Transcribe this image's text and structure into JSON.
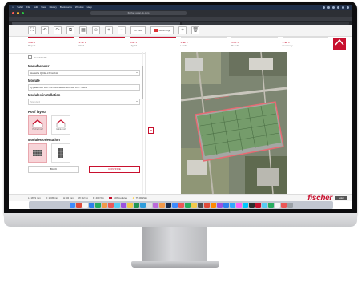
{
  "browser": {
    "menubar_items": [
      "Safari",
      "File",
      "Edit",
      "View",
      "History",
      "Bookmarks",
      "Window",
      "Help"
    ],
    "url": "fischer-solar-fix.com"
  },
  "toolbar": {
    "view_select": "2D view",
    "color_select": "Bleu/rouge"
  },
  "steps": [
    {
      "num": "STEP 1",
      "label": "Project"
    },
    {
      "num": "STEP 2",
      "label": "Roof"
    },
    {
      "num": "STEP 3",
      "label": "Layout"
    },
    {
      "num": "STEP 4",
      "label": "Loads"
    },
    {
      "num": "STEP 5",
      "label": "Results"
    },
    {
      "num": "STEP 6",
      "label": "Summary"
    }
  ],
  "logo_text": "fischer",
  "panel": {
    "use_defaults": "Use defaults",
    "manufacturer_label": "Manufacturer",
    "manufacturer_value": "Hanwha Q CELLS GmbH",
    "module_label": "Module",
    "module_value": "Q.peak Duo BLK ML-G10 Series 385 400 Wp - 400W",
    "modules_installation_label": "Modules installation",
    "modules_installation_value": "Standard",
    "roof_layout_label": "Roof layout",
    "roof_options": [
      "Pitched roof",
      "Gable roof"
    ],
    "modules_orientation_label": "Modules orientation",
    "back": "BACK",
    "continue": "CONTINUE"
  },
  "statusbar": {
    "items": [
      "L: 1879 mm",
      "B: 1045 mm",
      "H: 32 mm",
      "W: 22 kg",
      "P: 400 Wp"
    ],
    "module_count": "108 modules",
    "power": "75.00 kWp"
  },
  "brand": {
    "name": "fischer",
    "badge": "solar"
  },
  "colors": {
    "accent": "#c8102e",
    "menubar": "#1f2f4a"
  }
}
